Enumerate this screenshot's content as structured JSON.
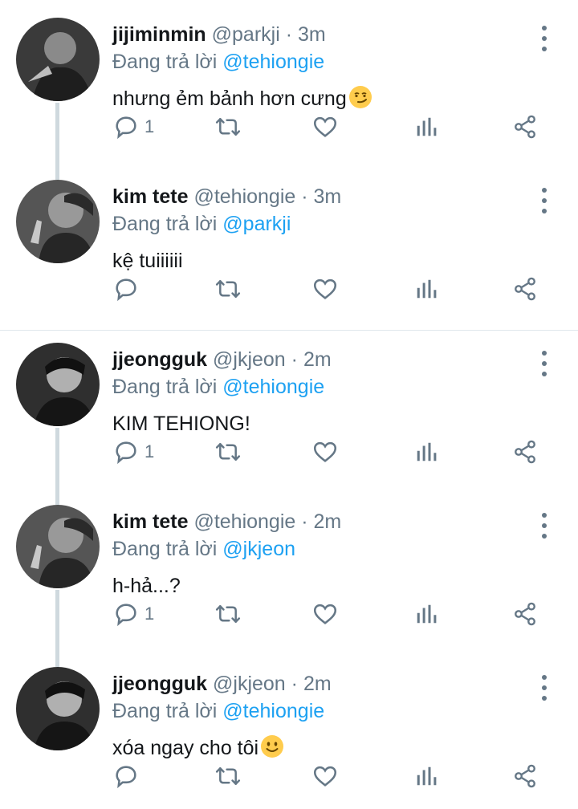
{
  "tweets": [
    {
      "name": "jijiminmin",
      "handle": "@parkji",
      "sep": "·",
      "time": "3m",
      "reply_prefix": "Đang trả lời",
      "reply_to": "@tehiongie",
      "text": "nhưng ẻm bảnh hơn cưng",
      "emoji": "smirk",
      "reply_count": "1"
    },
    {
      "name": "kim tete",
      "handle": "@tehiongie",
      "sep": "·",
      "time": "3m",
      "reply_prefix": "Đang trả lời",
      "reply_to": "@parkji",
      "text": "kệ tuiiiiii",
      "emoji": "",
      "reply_count": ""
    },
    {
      "name": "jjeongguk",
      "handle": "@jkjeon",
      "sep": "·",
      "time": "2m",
      "reply_prefix": "Đang trả lời",
      "reply_to": "@tehiongie",
      "text": "KIM TEHIONG!",
      "emoji": "",
      "reply_count": "1"
    },
    {
      "name": "kim tete",
      "handle": "@tehiongie",
      "sep": "·",
      "time": "2m",
      "reply_prefix": "Đang trả lời",
      "reply_to": "@jkjeon",
      "text": "h-hả...?",
      "emoji": "",
      "reply_count": "1"
    },
    {
      "name": "jjeongguk",
      "handle": "@jkjeon",
      "sep": "·",
      "time": "2m",
      "reply_prefix": "Đang trả lời",
      "reply_to": "@tehiongie",
      "text": "xóa ngay cho tôi",
      "emoji": "smile",
      "reply_count": ""
    }
  ],
  "icons": {
    "reply": "reply-icon",
    "retweet": "retweet-icon",
    "like": "heart-icon",
    "analytics": "analytics-icon",
    "share": "share-icon",
    "more": "more-vertical-icon"
  },
  "colors": {
    "mention": "#1da1f2",
    "muted": "#657786",
    "thread_line": "#cfd9de"
  }
}
